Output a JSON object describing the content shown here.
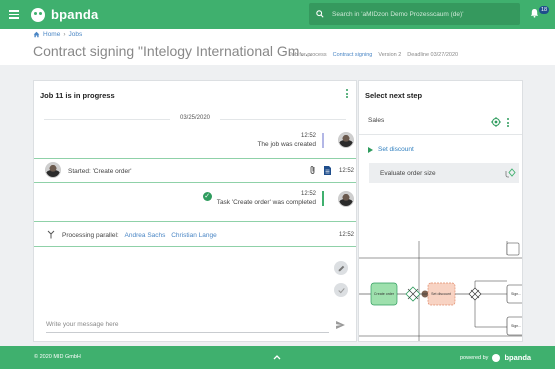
{
  "topbar": {
    "brand": "bpanda",
    "search_placeholder": "Search in 'aMIDzon Demo Prozesscaum (de)'",
    "notification_count": "18"
  },
  "header": {
    "breadcrumb": [
      "Home",
      "Jobs"
    ],
    "title": "Contract signing \"Intelogy International Gm…",
    "meta": {
      "job_label": "Job for process",
      "process_link": "Contract signing",
      "version": "Version 2",
      "deadline": "Deadline 03/27/2020"
    }
  },
  "job_panel": {
    "title": "Job 11 is in progress",
    "date": "03/25/2020",
    "messages": [
      {
        "time": "12:52",
        "text": "The job was created"
      },
      {
        "time": "12:52",
        "text": "Started: 'Create order'"
      },
      {
        "time": "12:52",
        "text": "Task 'Create order' was completed"
      },
      {
        "time": "12:52",
        "label": "Processing parallel:",
        "people": [
          "Andrea Sachs",
          "Christian Lange"
        ]
      }
    ],
    "input_placeholder": "Write your message here"
  },
  "next_step_panel": {
    "title": "Select next step",
    "lane": "Sales",
    "steps": [
      "Set discount",
      "Evaluate order size"
    ],
    "diagram": {
      "tasks": [
        "Create order",
        "Set discount",
        "Sign...",
        "Sign..."
      ]
    }
  },
  "footer": {
    "copyright": "© 2020 MID GmbH",
    "powered_by": "powered by",
    "brand": "bpanda"
  },
  "colors": {
    "brand_green": "#3fb06e",
    "link_blue": "#4a86c5"
  }
}
